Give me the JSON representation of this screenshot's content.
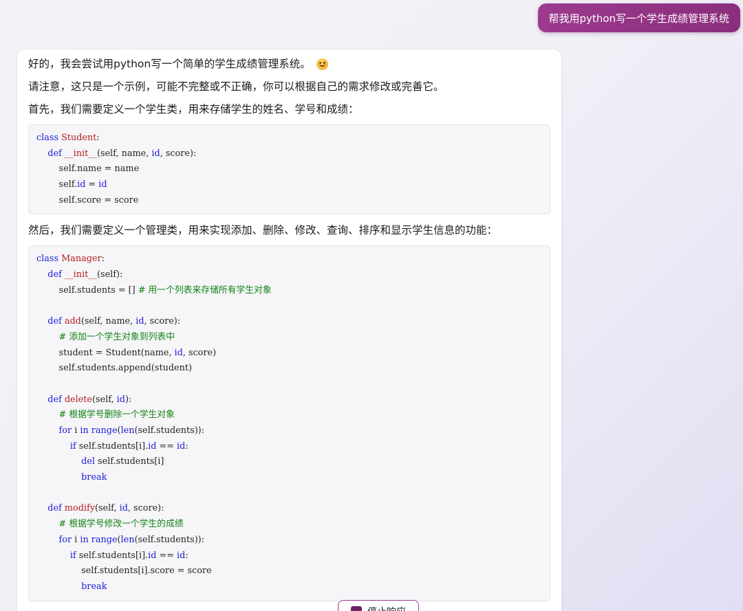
{
  "user_message": "帮我用python写一个学生成绩管理系统",
  "bot": {
    "intro": "好的，我会尝试用python写一个简单的学生成绩管理系统。",
    "emoji_icon": "smiling-face-icon",
    "note": "请注意，这只是一个示例，可能不完整或不正确，你可以根据自己的需求修改或完善它。",
    "step1": "首先，我们需要定义一个学生类，用来存储学生的姓名、学号和成绩：",
    "code1": [
      [
        [
          "class ",
          "kw"
        ],
        [
          "Student",
          "fn"
        ],
        [
          ":",
          ""
        ]
      ],
      [
        [
          "    ",
          ""
        ],
        [
          "def ",
          "kw"
        ],
        [
          "__init__",
          "fn"
        ],
        [
          "(self, name, ",
          ""
        ],
        [
          "id",
          "kw"
        ],
        [
          ", score):",
          ""
        ]
      ],
      [
        [
          "        self.name = name",
          ""
        ]
      ],
      [
        [
          "        self.",
          ""
        ],
        [
          "id",
          "kw"
        ],
        [
          " = ",
          ""
        ],
        [
          "id",
          "kw"
        ]
      ],
      [
        [
          "        self.score = score",
          ""
        ]
      ]
    ],
    "step2": "然后，我们需要定义一个管理类，用来实现添加、删除、修改、查询、排序和显示学生信息的功能：",
    "code2": [
      [
        [
          "class ",
          "kw"
        ],
        [
          "Manager",
          "fn"
        ],
        [
          ":",
          ""
        ]
      ],
      [
        [
          "    ",
          ""
        ],
        [
          "def ",
          "kw"
        ],
        [
          "__init__",
          "fn"
        ],
        [
          "(self):",
          ""
        ]
      ],
      [
        [
          "        self.students = [] ",
          ""
        ],
        [
          "# 用一个列表来存储所有学生对象",
          "cm"
        ]
      ],
      [],
      [
        [
          "    ",
          ""
        ],
        [
          "def ",
          "kw"
        ],
        [
          "add",
          "fn"
        ],
        [
          "(self, name, ",
          ""
        ],
        [
          "id",
          "kw"
        ],
        [
          ", score):",
          ""
        ]
      ],
      [
        [
          "        ",
          ""
        ],
        [
          "# 添加一个学生对象到列表中",
          "cm"
        ]
      ],
      [
        [
          "        student = Student(name, ",
          ""
        ],
        [
          "id",
          "kw"
        ],
        [
          ", score)",
          ""
        ]
      ],
      [
        [
          "        self.students.append(student)",
          ""
        ]
      ],
      [],
      [
        [
          "    ",
          ""
        ],
        [
          "def ",
          "kw"
        ],
        [
          "delete",
          "fn"
        ],
        [
          "(self, ",
          ""
        ],
        [
          "id",
          "kw"
        ],
        [
          "):",
          ""
        ]
      ],
      [
        [
          "        ",
          ""
        ],
        [
          "# 根据学号删除一个学生对象",
          "cm"
        ]
      ],
      [
        [
          "        ",
          ""
        ],
        [
          "for ",
          "kw"
        ],
        [
          "i ",
          ""
        ],
        [
          "in ",
          "kw"
        ],
        [
          "range",
          "kw"
        ],
        [
          "(",
          ""
        ],
        [
          "len",
          "kw"
        ],
        [
          "(self.students)):",
          ""
        ]
      ],
      [
        [
          "            ",
          ""
        ],
        [
          "if ",
          "kw"
        ],
        [
          "self.students[i].",
          ""
        ],
        [
          "id",
          "kw"
        ],
        [
          " == ",
          ""
        ],
        [
          "id",
          "kw"
        ],
        [
          ":",
          ""
        ]
      ],
      [
        [
          "                ",
          ""
        ],
        [
          "del ",
          "kw"
        ],
        [
          "self.students[i]",
          ""
        ]
      ],
      [
        [
          "                ",
          ""
        ],
        [
          "break",
          "kw"
        ]
      ],
      [],
      [
        [
          "    ",
          ""
        ],
        [
          "def ",
          "kw"
        ],
        [
          "modify",
          "fn"
        ],
        [
          "(self, ",
          ""
        ],
        [
          "id",
          "kw"
        ],
        [
          ", score):",
          ""
        ]
      ],
      [
        [
          "        ",
          ""
        ],
        [
          "# 根据学号修改一个学生的成绩",
          "cm"
        ]
      ],
      [
        [
          "        ",
          ""
        ],
        [
          "for ",
          "kw"
        ],
        [
          "i ",
          ""
        ],
        [
          "in ",
          "kw"
        ],
        [
          "range",
          "kw"
        ],
        [
          "(",
          ""
        ],
        [
          "len",
          "kw"
        ],
        [
          "(self.students)):",
          ""
        ]
      ],
      [
        [
          "            ",
          ""
        ],
        [
          "if ",
          "kw"
        ],
        [
          "self.students[i].",
          ""
        ],
        [
          "id",
          "kw"
        ],
        [
          " == ",
          ""
        ],
        [
          "id",
          "kw"
        ],
        [
          ":",
          ""
        ]
      ],
      [
        [
          "                self.students[i].score = score",
          ""
        ]
      ],
      [
        [
          "                ",
          ""
        ],
        [
          "break",
          "kw"
        ]
      ]
    ]
  },
  "stop_button": {
    "label": "停止响应",
    "icon": "stop-square-icon"
  },
  "colors": {
    "user_bubble": "#9d3a8e",
    "keyword": "#1a1ad4",
    "function_name": "#b31b1b",
    "comment": "#128212"
  }
}
